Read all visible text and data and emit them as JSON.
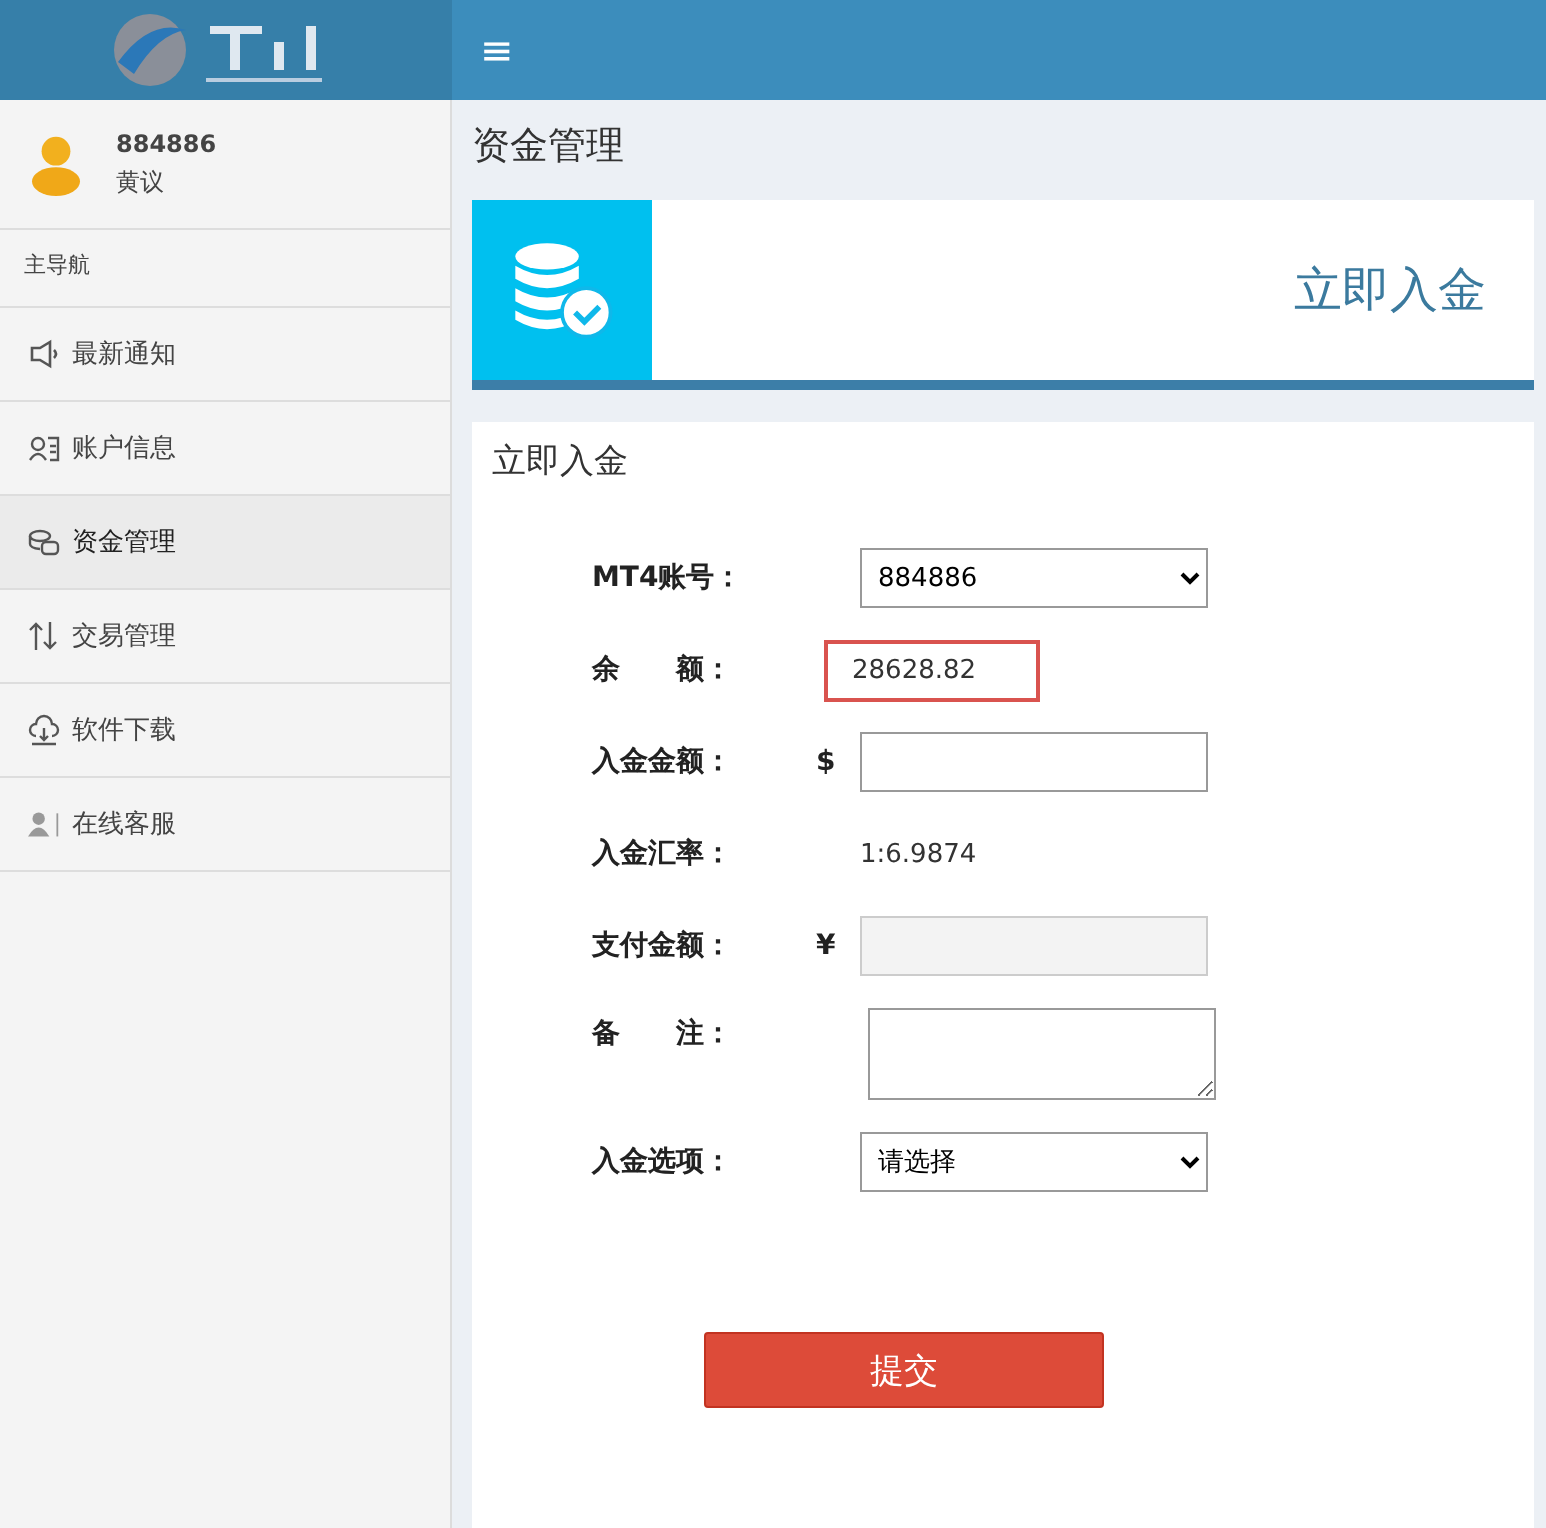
{
  "topbar": {
    "menu_icon": "≡"
  },
  "user": {
    "account": "884886",
    "name": "黄议"
  },
  "sidebar": {
    "heading": "主导航",
    "items": [
      {
        "label": "最新通知",
        "selected": false
      },
      {
        "label": "账户信息",
        "selected": false
      },
      {
        "label": "资金管理",
        "selected": true
      },
      {
        "label": "交易管理",
        "selected": false
      },
      {
        "label": "软件下载",
        "selected": false
      },
      {
        "label": "在线客服",
        "selected": false
      }
    ]
  },
  "page_title": "资金管理",
  "banner": {
    "title": "立即入金"
  },
  "form": {
    "title": "立即入金",
    "fields": [
      {
        "kind": "select",
        "label": "MT4账号：",
        "value": "884886"
      },
      {
        "kind": "readonly",
        "label": "余　　额：",
        "value": "28628.82",
        "highlighted": true
      },
      {
        "kind": "input",
        "label": "入金金额：",
        "prefix": "$"
      },
      {
        "kind": "text",
        "label": "入金汇率：",
        "value": "1:6.9874"
      },
      {
        "kind": "disabled",
        "label": "支付金额：",
        "prefix": "¥"
      },
      {
        "kind": "textarea",
        "label": "备　　注："
      },
      {
        "kind": "select",
        "label": "入金选项：",
        "value": "请选择"
      }
    ],
    "submit": "提交"
  }
}
